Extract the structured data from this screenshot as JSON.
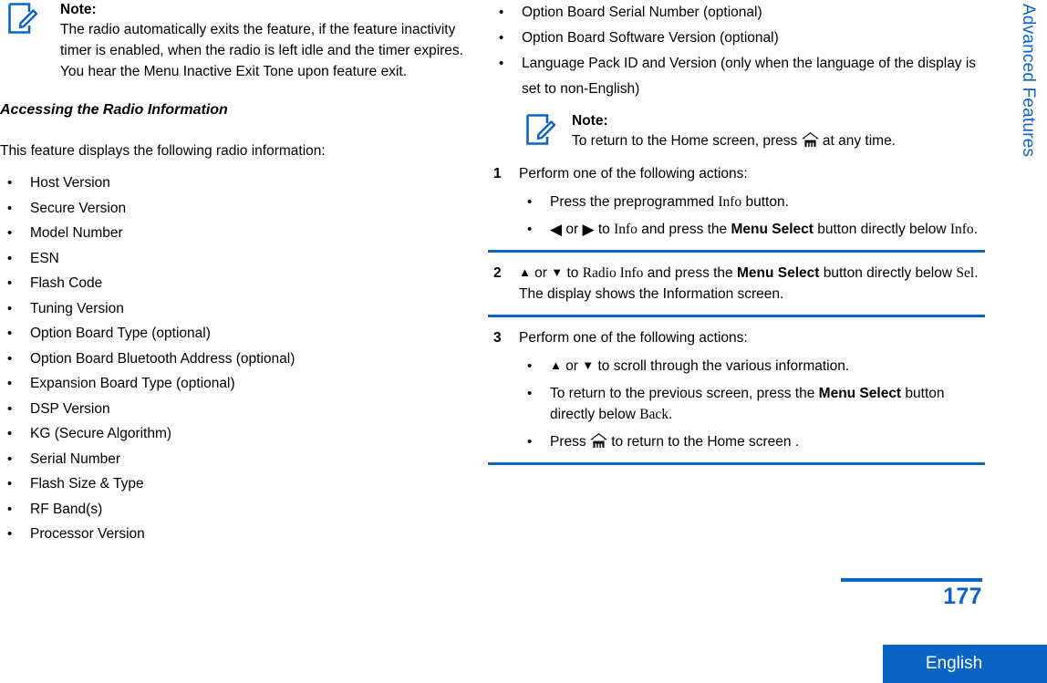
{
  "accent_color": "#0b63c5",
  "left_column": {
    "note": {
      "icon": "note-pencil-icon",
      "title": "Note:",
      "body": "The radio automatically exits the feature, if the feature inactivity timer is enabled, when the radio is left idle and the timer expires. You hear the Menu Inactive Exit Tone upon feature exit."
    },
    "heading": "Accessing the Radio Information",
    "intro": "This feature displays the following radio information:",
    "info_items": [
      "Host Version",
      "Secure Version",
      "Model Number",
      "ESN",
      "Flash Code",
      "Tuning Version",
      "Option Board Type (optional)",
      "Option Board Bluetooth Address (optional)",
      "Expansion Board Type (optional)",
      "DSP Version",
      "KG (Secure Algorithm)",
      "Serial Number",
      "Flash Size & Type",
      "RF Band(s)",
      "Processor Version"
    ]
  },
  "right_column": {
    "info_items_continued": [
      "Option Board Serial Number (optional)",
      "Option Board Software Version (optional)",
      "Language Pack ID and Version (only when the language of the display is set to non-English)"
    ],
    "note": {
      "icon": "note-pencil-icon",
      "title": "Note:",
      "body_before_icon": "To return to the Home screen, press",
      "body_icon": "home-icon",
      "body_after_icon": "at any time."
    },
    "steps": [
      {
        "number": "1",
        "text": "Perform one of the following actions:",
        "substeps": [
          {
            "parts": [
              {
                "type": "text",
                "value": "Press the preprogrammed "
              },
              {
                "type": "serif",
                "value": "Info"
              },
              {
                "type": "text",
                "value": " button."
              }
            ]
          },
          {
            "parts": [
              {
                "type": "icon",
                "value": "arrow-left-icon",
                "glyph": "◀"
              },
              {
                "type": "text",
                "value": " or "
              },
              {
                "type": "icon",
                "value": "arrow-right-icon",
                "glyph": "▶"
              },
              {
                "type": "text",
                "value": " to "
              },
              {
                "type": "serif",
                "value": "Info"
              },
              {
                "type": "text",
                "value": " and press the "
              },
              {
                "type": "bold",
                "value": "Menu Select"
              },
              {
                "type": "text",
                "value": " button directly below "
              },
              {
                "type": "serif",
                "value": "Info"
              },
              {
                "type": "text",
                "value": "."
              }
            ]
          }
        ]
      },
      {
        "number": "2",
        "parts": [
          {
            "type": "icon",
            "value": "arrow-up-icon",
            "glyph": "▲"
          },
          {
            "type": "text",
            "value": " or "
          },
          {
            "type": "icon",
            "value": "arrow-down-icon",
            "glyph": "▼"
          },
          {
            "type": "text",
            "value": " to "
          },
          {
            "type": "serif",
            "value": "Radio Info"
          },
          {
            "type": "text",
            "value": " and press the "
          },
          {
            "type": "bold",
            "value": "Menu Select"
          },
          {
            "type": "text",
            "value": " button directly below "
          },
          {
            "type": "serif",
            "value": "Sel"
          },
          {
            "type": "text",
            "value": "."
          }
        ],
        "result": "The display shows the Information screen."
      },
      {
        "number": "3",
        "text": "Perform one of the following actions:",
        "substeps": [
          {
            "parts": [
              {
                "type": "icon",
                "value": "arrow-up-icon",
                "glyph": "▲"
              },
              {
                "type": "text",
                "value": " or "
              },
              {
                "type": "icon",
                "value": "arrow-down-icon",
                "glyph": "▼"
              },
              {
                "type": "text",
                "value": " to scroll through the various information."
              }
            ]
          },
          {
            "parts": [
              {
                "type": "text",
                "value": "To return to the previous screen, press the "
              },
              {
                "type": "bold",
                "value": "Menu Select"
              },
              {
                "type": "text",
                "value": " button directly below "
              },
              {
                "type": "serif",
                "value": "Back"
              },
              {
                "type": "text",
                "value": "."
              }
            ]
          },
          {
            "parts": [
              {
                "type": "text",
                "value": "Press "
              },
              {
                "type": "icon",
                "value": "home-icon",
                "glyph": "home"
              },
              {
                "type": "text",
                "value": " to return to the Home screen ."
              }
            ]
          }
        ]
      }
    ]
  },
  "side_tab": {
    "label": "Advanced Features"
  },
  "footer": {
    "page_number": "177",
    "language": "English"
  }
}
